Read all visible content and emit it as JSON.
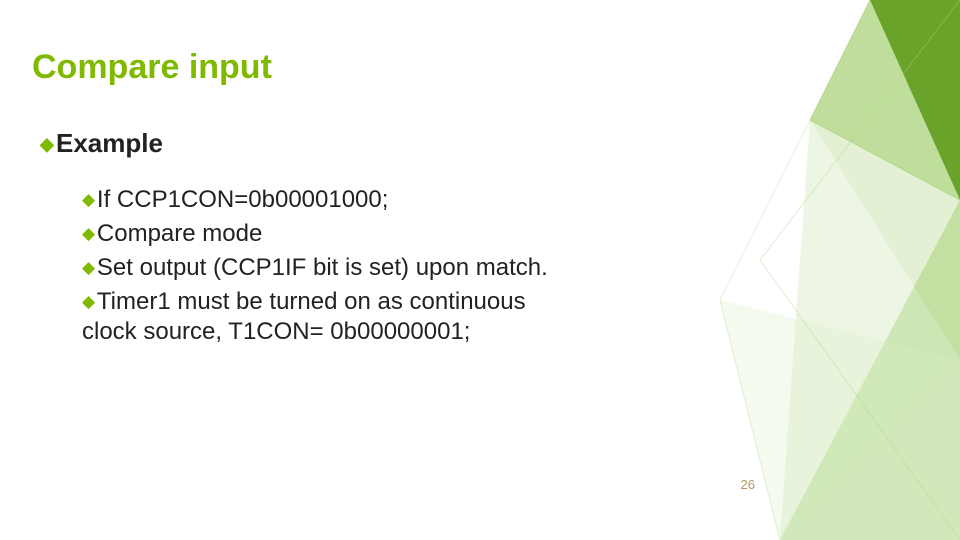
{
  "title": "Compare input",
  "bullets": {
    "b1": "Example",
    "b2a": "If CCP1CON=0b00001000;",
    "b2b": "Compare mode",
    "b2c": "Set output (CCP1IF bit is set) upon match.",
    "b2d": "Timer1 must be turned on as continuous clock source, T1CON= 0b00000001;"
  },
  "page_number": "26"
}
